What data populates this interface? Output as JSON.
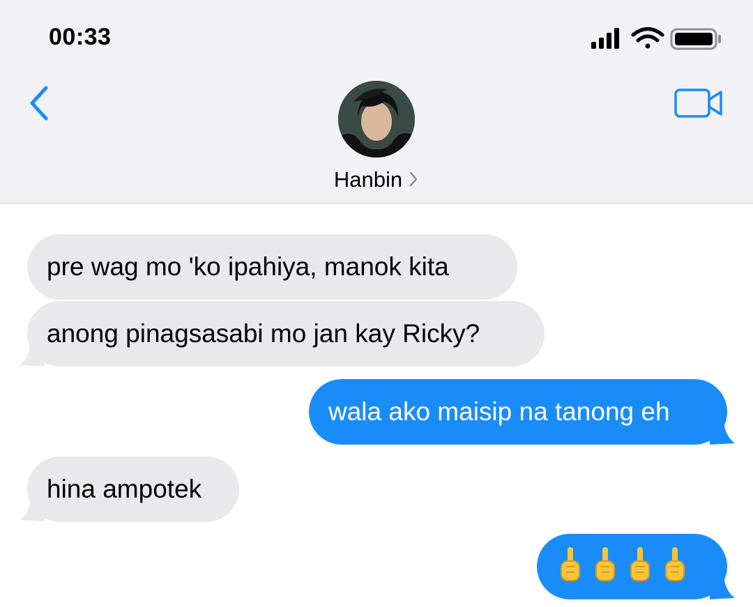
{
  "status_bar": {
    "time": "00:33"
  },
  "header": {
    "contact_name": "Hanbin",
    "back_icon": "chevron-left-icon",
    "video_icon": "video-camera-icon"
  },
  "colors": {
    "accent": "#1a8cf9",
    "received_bubble": "#e9e9eb",
    "header_bg": "#f1f1f6"
  },
  "messages": [
    {
      "direction": "received",
      "text": "pre wag mo 'ko ipahiya, manok kita"
    },
    {
      "direction": "received",
      "text": "anong pinagsasabi mo jan kay Ricky?"
    },
    {
      "direction": "sent",
      "text": "wala ako maisip na tanong eh"
    },
    {
      "direction": "received",
      "text": "hina ampotek"
    },
    {
      "direction": "sent",
      "text": "🖕🖕🖕🖕",
      "content": "middle-finger-emoji x4"
    }
  ]
}
